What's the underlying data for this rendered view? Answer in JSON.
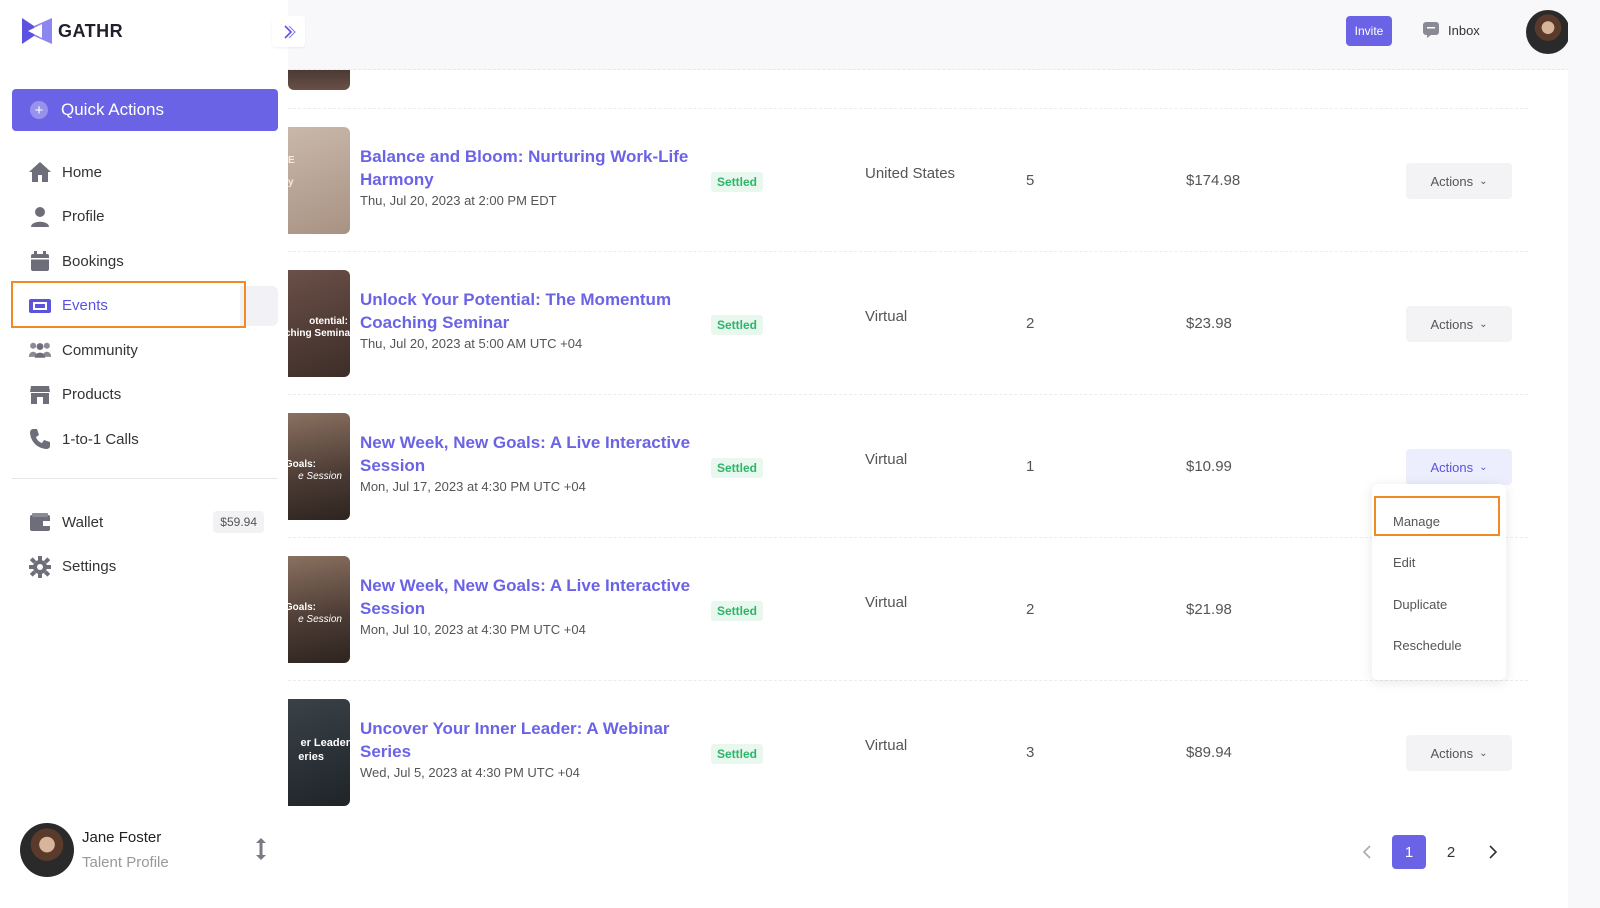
{
  "brand": {
    "name": "GATHR"
  },
  "sidebar": {
    "quick_actions_label": "Quick Actions",
    "items": [
      {
        "label": "Home",
        "icon": "home-icon"
      },
      {
        "label": "Profile",
        "icon": "user-icon"
      },
      {
        "label": "Bookings",
        "icon": "calendar-icon"
      },
      {
        "label": "Events",
        "icon": "ticket-icon",
        "active": true
      },
      {
        "label": "Community",
        "icon": "users-icon"
      },
      {
        "label": "Products",
        "icon": "store-icon"
      },
      {
        "label": "1-to-1 Calls",
        "icon": "phone-icon"
      }
    ],
    "wallet": {
      "label": "Wallet",
      "balance": "$59.94",
      "icon": "wallet-icon"
    },
    "settings": {
      "label": "Settings",
      "icon": "gear-icon"
    },
    "user": {
      "name": "Jane Foster",
      "role": "Talent Profile"
    }
  },
  "topbar": {
    "invite_label": "Invite",
    "inbox_label": "Inbox"
  },
  "events": [
    {
      "title": "Balance and Bloom: Nurturing Work-Life Harmony",
      "date": "Thu, Jul 20, 2023 at 2:00 PM EDT",
      "status": "Settled",
      "location": "United States",
      "qty": "5",
      "amount": "$174.98",
      "actions": "Actions",
      "thumb_text": [
        "E",
        "y"
      ]
    },
    {
      "title": "Unlock Your Potential: The Momentum Coaching Seminar",
      "date": "Thu, Jul 20, 2023 at 5:00 AM UTC +04",
      "status": "Settled",
      "location": "Virtual",
      "qty": "2",
      "amount": "$23.98",
      "actions": "Actions",
      "thumb_text": [
        "otential:",
        "ching Semina"
      ]
    },
    {
      "title": "New Week, New Goals: A Live Interactive Session",
      "date": "Mon, Jul 17, 2023 at 4:30 PM UTC +04",
      "status": "Settled",
      "location": "Virtual",
      "qty": "1",
      "amount": "$10.99",
      "actions": "Actions",
      "thumb_text": [
        "Goals:",
        "e Session"
      ]
    },
    {
      "title": "New Week, New Goals: A Live Interactive Session",
      "date": "Mon, Jul 10, 2023 at 4:30 PM UTC +04",
      "status": "Settled",
      "location": "Virtual",
      "qty": "2",
      "amount": "$21.98",
      "actions": "Actions",
      "thumb_text": [
        "Goals:",
        "e Session"
      ]
    },
    {
      "title": "Uncover Your Inner Leader: A Webinar Series",
      "date": "Wed, Jul 5, 2023 at 4:30 PM UTC +04",
      "status": "Settled",
      "location": "Virtual",
      "qty": "3",
      "amount": "$89.94",
      "actions": "Actions",
      "thumb_text": [
        "er Leader",
        "eries"
      ]
    }
  ],
  "dropdown": {
    "items": [
      "Manage",
      "Edit",
      "Duplicate",
      "Reschedule"
    ]
  },
  "pagination": {
    "pages": [
      "1",
      "2"
    ],
    "current": "1"
  },
  "colors": {
    "accent": "#6b63e6",
    "highlight": "#f08a24",
    "settled_bg": "#e8f8ee",
    "settled_text": "#2db56a"
  }
}
